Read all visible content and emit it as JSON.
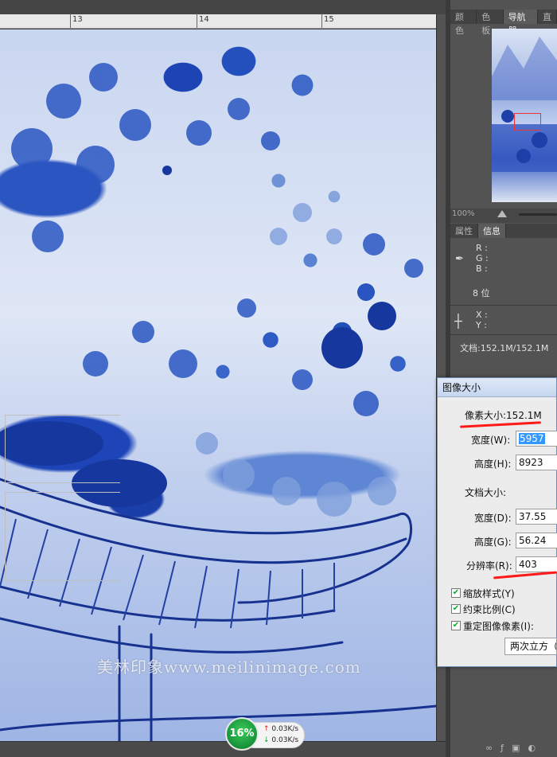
{
  "ruler": {
    "marks": [
      "13",
      "14",
      "15"
    ]
  },
  "panels": {
    "top_tabs": [
      "颜色",
      "色板",
      "导航器",
      "直"
    ],
    "active_top_tab": "导航器",
    "navigator_zoom": "100%",
    "info_tabs": [
      "属性",
      "信息"
    ],
    "active_info_tab": "信息",
    "info": {
      "r_label": "R :",
      "g_label": "G :",
      "b_label": "B :",
      "bit_depth": "8 位",
      "x_label": "X :",
      "y_label": "Y :",
      "doc_size": "文档:152.1M/152.1M"
    }
  },
  "dialog": {
    "title": "图像大小",
    "pixel_dimensions": "像素大小:152.1M",
    "width_label": "宽度(W):",
    "width_value": "5957",
    "height_label": "高度(H):",
    "height_value": "8923",
    "document_size_legend": "文档大小:",
    "doc_width_label": "宽度(D):",
    "doc_width_value": "37.55",
    "doc_height_label": "高度(G):",
    "doc_height_value": "56.24",
    "resolution_label": "分辨率(R):",
    "resolution_value": "403",
    "scale_styles": "缩放样式(Y)",
    "constrain_proportions": "约束比例(C)",
    "resample_image": "重定图像像素(I):",
    "resample_method": "两次立方（"
  },
  "watermark": "美林印象www.meilinimage.com",
  "network": {
    "percent": "16%",
    "upload": "0.03K/s",
    "download": "0.03K/s"
  },
  "colors": {
    "highlight": "#ff1a1a",
    "selection": "#3399ff",
    "porcelain_blue": "#1d44b5"
  }
}
